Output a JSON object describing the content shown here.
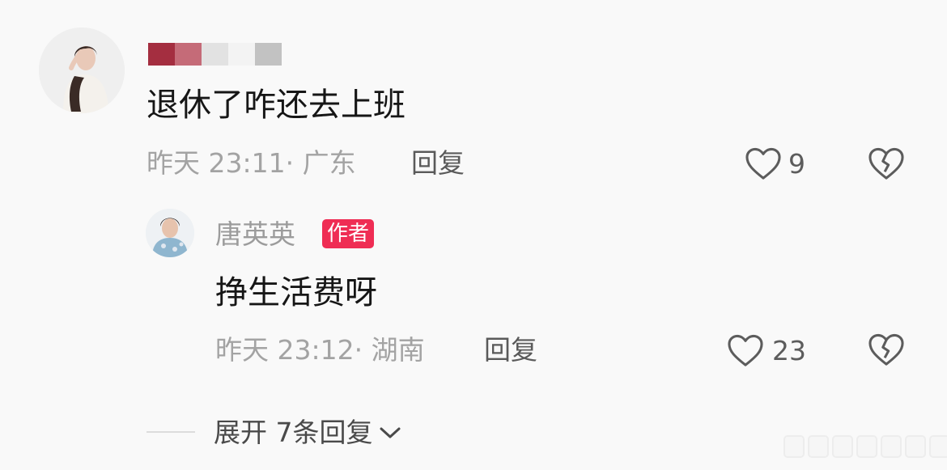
{
  "colors": {
    "background": "#f9f9f9",
    "author_badge": "#ef2d54",
    "meta_text": "#a3a3a3"
  },
  "comment": {
    "username_censored_colors": [
      "#a42e40",
      "#c56b78",
      "#e2e2e2",
      "#f3f3f3",
      "#c2c2c2"
    ],
    "text": "退休了咋还去上班",
    "time_location": "昨天 23:11· 广东",
    "reply_label": "回复",
    "like_count": "9",
    "like_icon": "heart-outline-icon",
    "dislike_icon": "broken-heart-icon"
  },
  "reply": {
    "author_name": "唐英英",
    "author_badge": "作者",
    "text": "挣生活费呀",
    "time_location": "昨天 23:12· 湖南",
    "reply_label": "回复",
    "like_count": "23",
    "like_icon": "heart-outline-icon",
    "dislike_icon": "broken-heart-icon"
  },
  "expand": {
    "label": "展开 7条回复",
    "icon": "chevron-down-icon"
  }
}
